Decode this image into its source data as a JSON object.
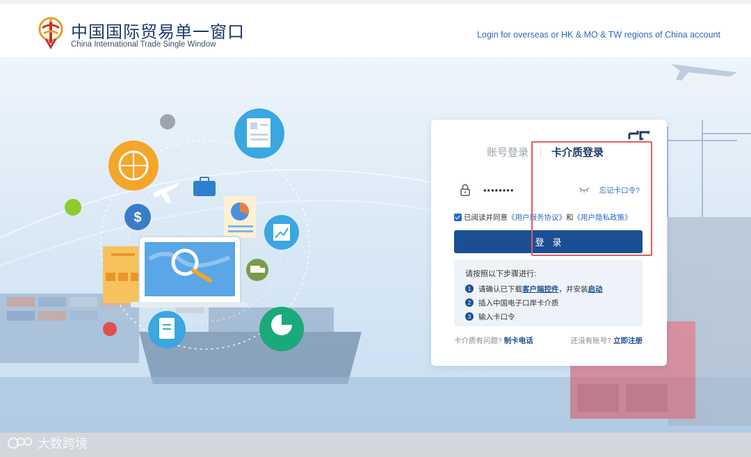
{
  "header": {
    "brand_cn": "中国国际贸易单一窗口",
    "brand_en": "China International Trade Single Window",
    "overseas_link": "Login for overseas or HK & MO & TW regions of China account"
  },
  "login": {
    "tabs": [
      {
        "label": "账号登录",
        "active": false
      },
      {
        "label": "卡介质登录",
        "active": true
      }
    ],
    "password_value": "••••••••",
    "forgot_link": "忘记卡口令?",
    "agreement": {
      "checked": true,
      "prefix": "已阅读并同意",
      "service_agreement": "《用户服务协议》",
      "and": "和",
      "privacy_policy": "《用户隐私政策》"
    },
    "login_button": "登录",
    "steps": {
      "title": "请按照以下步骤进行:",
      "items": [
        {
          "num": "1",
          "pre": "请确认已下载",
          "link": "客户端控件",
          "mid": "，并安装",
          "link2": "启动"
        },
        {
          "num": "2",
          "text": "插入中国电子口岸卡介质"
        },
        {
          "num": "3",
          "text": "输入卡口令"
        }
      ]
    },
    "footer": {
      "card_question": "卡介质有问题?",
      "card_phone": "制卡电话",
      "no_account": "还没有账号?",
      "register": "立即注册"
    }
  },
  "watermark": "大数跨境",
  "colors": {
    "brand_blue": "#1b4f94",
    "link_blue": "#2a6ac2",
    "highlight_red": "#e35b5b"
  }
}
